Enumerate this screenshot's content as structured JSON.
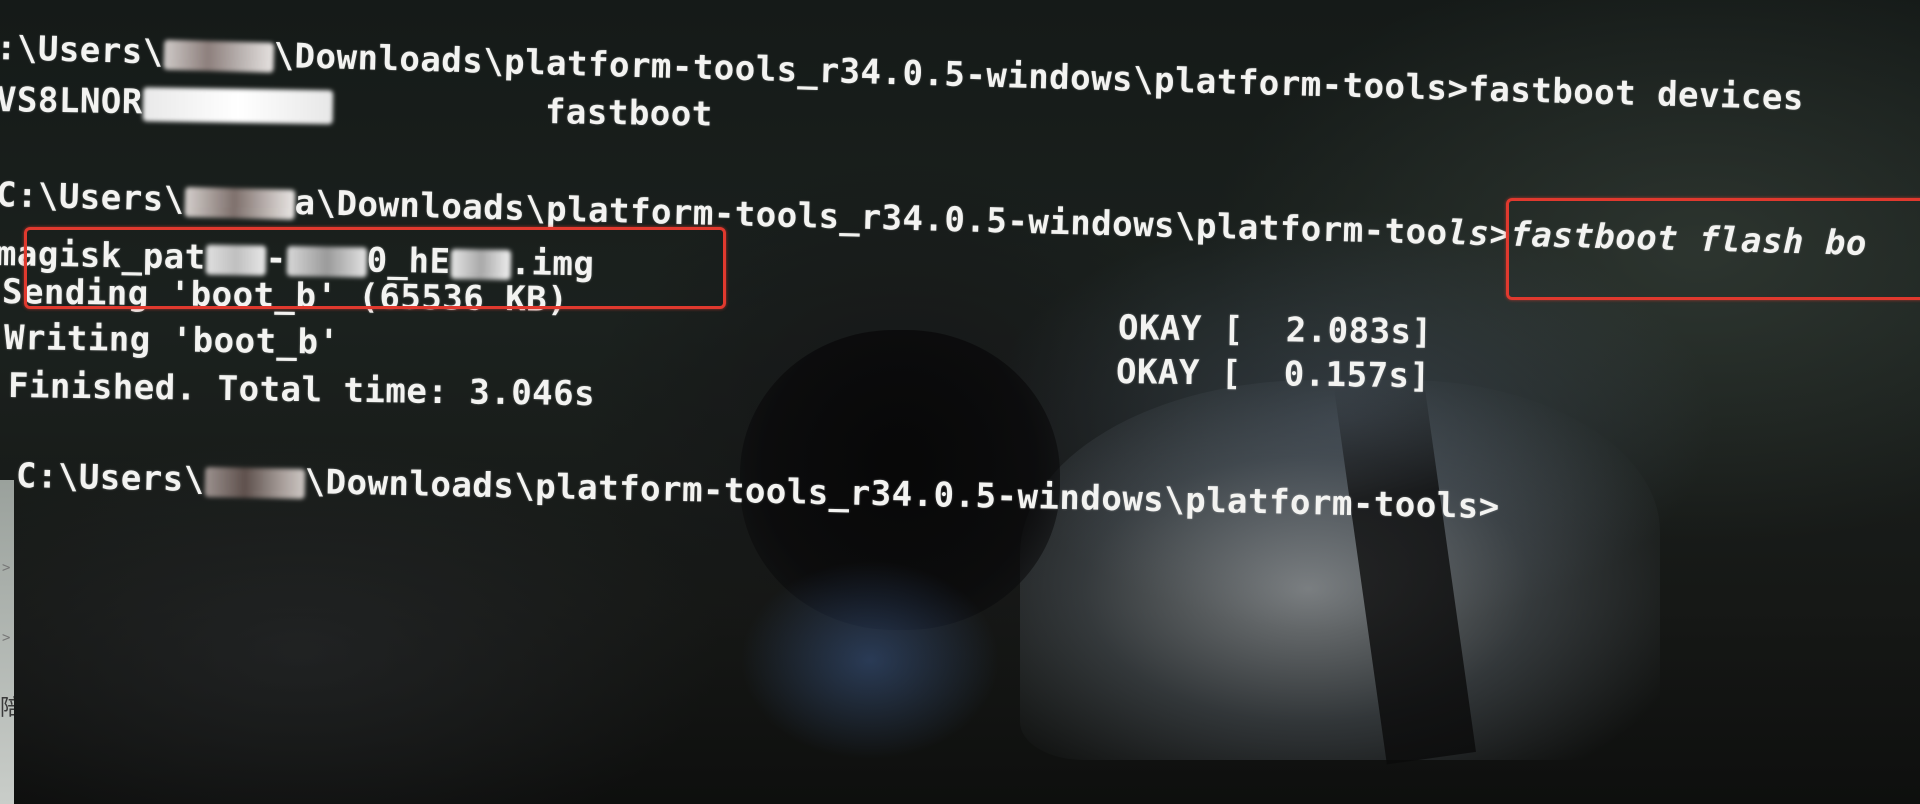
{
  "colors": {
    "terminal_text": "#f3f3f1",
    "highlight_box": "#e0392e",
    "background": "#101412"
  },
  "terminal": {
    "line1": {
      "prefix": ":\\Users\\",
      "suffix": "\\Downloads\\platform-tools_r34.0.5-windows\\platform-tools>fastboot devices"
    },
    "line2": {
      "serial_prefix": "VS8LNOR",
      "mode": "fastboot"
    },
    "line3": {
      "prefix": "C:\\Users\\",
      "middle": "a\\Downloads\\platform-tools_r34.0.5-windows\\platform-too",
      "suffix": "ls>fastboot flash bo"
    },
    "line4": {
      "part1": "magisk_pat",
      "part2": "-",
      "part3": "0_hE",
      "part4": ".img"
    },
    "line5": "Sending 'boot_b' (65536 KB)",
    "line6": "Writing 'boot_b'",
    "line7": "Finished. Total time: 3.046s",
    "line8": {
      "prefix": "C:\\Users\\",
      "suffix": "\\Downloads\\platform-tools_r34.0.5-windows\\platform-tools>"
    },
    "okay1": "OKAY [  2.083s]",
    "okay2": "OKAY [  0.157s]"
  },
  "side_chars": {
    "glyph_a": ">",
    "glyph_b": ">",
    "glyph_c": "陪"
  }
}
